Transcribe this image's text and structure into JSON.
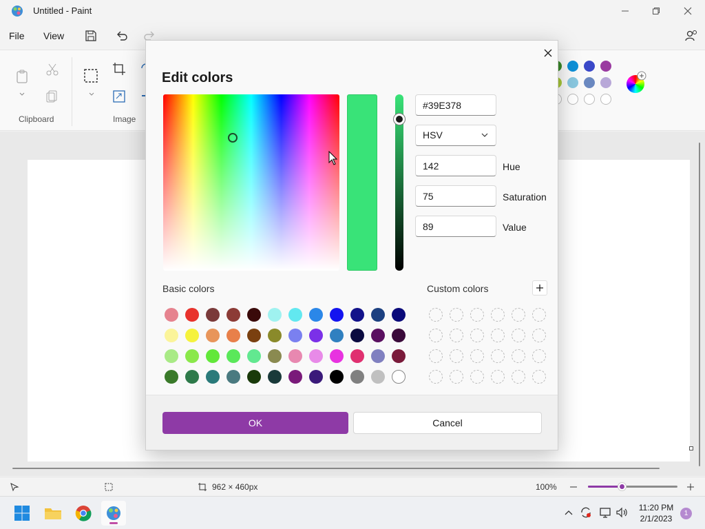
{
  "window": {
    "title": "Untitled - Paint"
  },
  "menu": {
    "file": "File",
    "view": "View"
  },
  "ribbon": {
    "clipboard_label": "Clipboard",
    "image_label": "Image"
  },
  "status": {
    "dimensions": "962 × 460px",
    "zoom": "100%",
    "zoom_level": 0.38
  },
  "taskbar": {
    "time": "11:20 PM",
    "date": "2/1/2023",
    "notification_count": "1"
  },
  "dialog": {
    "title": "Edit colors",
    "hex_value": "#39E378",
    "mode": "HSV",
    "hue": {
      "label": "Hue",
      "value": "142"
    },
    "saturation": {
      "label": "Saturation",
      "value": "75"
    },
    "value": {
      "label": "Value",
      "value": "89"
    },
    "basic_colors_label": "Basic colors",
    "custom_colors_label": "Custom colors",
    "ok_label": "OK",
    "cancel_label": "Cancel",
    "current_color": "#39E378",
    "basic_colors": [
      "#e6838f",
      "#e8322c",
      "#7a3a3a",
      "#8c3b36",
      "#3a0a0a",
      "#9ff2f0",
      "#62e8f0",
      "#2b87e8",
      "#1414f0",
      "#12128a",
      "#1c4080",
      "#0a0a7a",
      "#fbf49a",
      "#f5f23c",
      "#e8955a",
      "#e8804a",
      "#7a4010",
      "#8a8a2a",
      "#7a80f0",
      "#7b30e8",
      "#3080c0",
      "#0a0a40",
      "#5a1060",
      "#3a0a3a",
      "#a9ea86",
      "#8ae84a",
      "#62e83a",
      "#5ae85a",
      "#62e890",
      "#8a8a50",
      "#e888b0",
      "#e88ae8",
      "#e832e0",
      "#e03070",
      "#8080c0",
      "#7a1a3a",
      "#3a7a2a",
      "#2e7a4a",
      "#2a7a7a",
      "#4a7a80",
      "#1a3a0a",
      "#1a3a3a",
      "#7a1a7a",
      "#3a1a7a",
      "#000000",
      "#808080",
      "#c0c0c0",
      "#ffffff"
    ],
    "custom_colors": [
      "",
      "",
      "",
      "",
      "",
      "",
      "",
      "",
      "",
      "",
      "",
      "",
      "",
      "",
      "",
      "",
      "",
      "",
      "",
      "",
      "",
      "",
      "",
      ""
    ]
  },
  "palette": {
    "row1": [
      "#3a8a2a",
      "#0e90d8",
      "#3a48c8",
      "#9a3aa0"
    ],
    "row2": [
      "#a8c838",
      "#8ac8e0",
      "#6a88c0",
      "#b8a8d8"
    ]
  },
  "colors": {
    "accent": "#8e3aa6"
  }
}
